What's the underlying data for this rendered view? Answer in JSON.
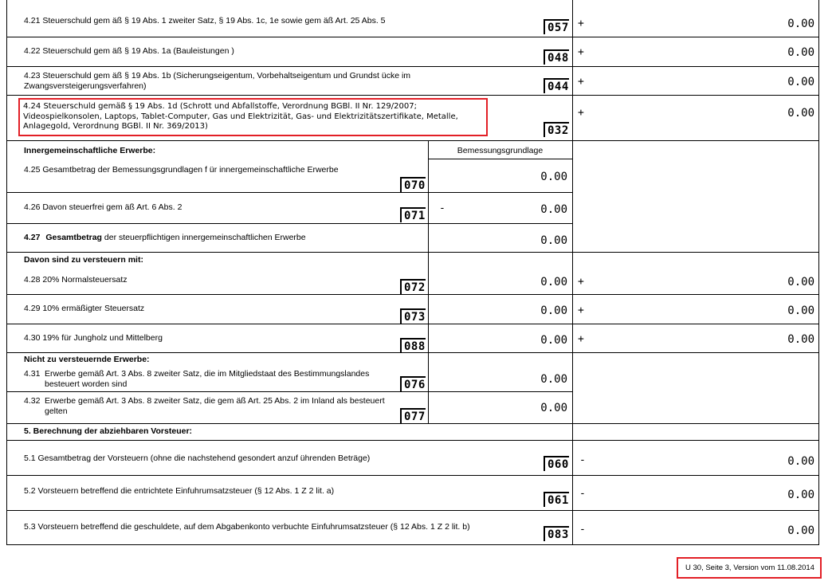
{
  "rows": {
    "r421": {
      "label": "4.21  Steuerschuld gem äß § 19 Abs. 1 zweiter Satz, § 19 Abs. 1c, 1e sowie gem äß Art. 25  Abs. 5",
      "code": "057",
      "sign": "+",
      "value": "0.00"
    },
    "r422": {
      "label": "4.22  Steuerschuld gem äß § 19 Abs. 1a (Bauleistungen )",
      "code": "048",
      "sign": "+",
      "value": "0.00"
    },
    "r423": {
      "label": "4.23  Steuerschuld gem äß § 19 Abs. 1b (Sicherungseigentum, Vorbehaltseigentum und Grundst  ücke im Zwangsversteigerungsverfahren)",
      "code": "044",
      "sign": "+",
      "value": "0.00"
    },
    "r424": {
      "label": "4.24 Steuerschuld gemäß § 19 Abs. 1d (Schrott und Abfallstoffe, Verordnung BGBl. II Nr. 129/2007; Videospielkonsolen, Laptops, Tablet-Computer, Gas und Elektrizität, Gas- und Elektrizitätszertifikate, Metalle, Anlagegold, Verordnung BGBl. II Nr. 369/2013)",
      "code": "032",
      "sign": "+",
      "value": "0.00"
    }
  },
  "ig": {
    "heading": "Innergemeinschaftliche Erwerbe:",
    "col_header": "Bemessungsgrundlage",
    "r425": {
      "label": "4.25  Gesamtbetrag der Bemessungsgrundlagen f ür innergemeinschaftliche Erwerbe",
      "code": "070",
      "value": "0.00"
    },
    "r426": {
      "label": "4.26  Davon steuerfrei gem äß Art. 6 Abs. 2",
      "code": "071",
      "sign": "-",
      "value": "0.00"
    },
    "r427": {
      "num": "4.27",
      "bold": "Gesamtbetrag",
      "rest": " der steuerpflichtigen innergemeinschaftlichen Erwerbe",
      "value": "0.00"
    }
  },
  "taxed": {
    "heading": "Davon sind zu versteuern mit:",
    "r428": {
      "label": "4.28  20% Normalsteuersatz",
      "code": "072",
      "value": "0.00",
      "sign": "+",
      "tax": "0.00"
    },
    "r429": {
      "label": "4.29  10% ermäßigter Steuersatz",
      "code": "073",
      "value": "0.00",
      "sign": "+",
      "tax": "0.00"
    },
    "r430": {
      "label": "4.30  19% für Jungholz und Mittelberg",
      "code": "088",
      "value": "0.00",
      "sign": "+",
      "tax": "0.00"
    }
  },
  "untaxed": {
    "heading": "Nicht zu versteuernde Erwerbe:",
    "r431": {
      "num": "4.31",
      "label": "Erwerbe gemäß Art. 3 Abs. 8 zweiter Satz, die im Mitgliedstaat des Bestimmungslandes besteuert worden sind",
      "code": "076",
      "value": "0.00"
    },
    "r432": {
      "num": "4.32",
      "label": "Erwerbe gemäß Art. 3 Abs. 8 zweiter Satz, die gem äß Art. 25 Abs. 2 im Inland als besteuert gelten",
      "code": "077",
      "value": "0.00"
    }
  },
  "vst": {
    "heading": "5.  Berechnung der abziehbaren Vorsteuer:",
    "r51": {
      "label": "5.1  Gesamtbetrag der Vorsteuern  (ohne die nachstehend gesondert anzuf ührenden Beträge)",
      "code": "060",
      "sign": "-",
      "value": "0.00"
    },
    "r52": {
      "label": "5.2  Vorsteuern betreffend die entrichtete Einfuhrumsatzsteuer   (§ 12 Abs. 1 Z 2 lit. a)",
      "code": "061",
      "sign": "-",
      "value": "0.00"
    },
    "r53": {
      "label": "5.3  Vorsteuern betreffend die geschuldete, auf dem Abgabenkonto verbuchte Einfuhrumsatzsteuer    (§ 12 Abs. 1 Z 2 lit. b)",
      "code": "083",
      "sign": "-",
      "value": "0.00"
    }
  },
  "footer": {
    "text": "U 30, Seite 3, Version vom 11.08.2014"
  },
  "colors": {
    "highlight": "#e21f26",
    "line": "#000000"
  }
}
